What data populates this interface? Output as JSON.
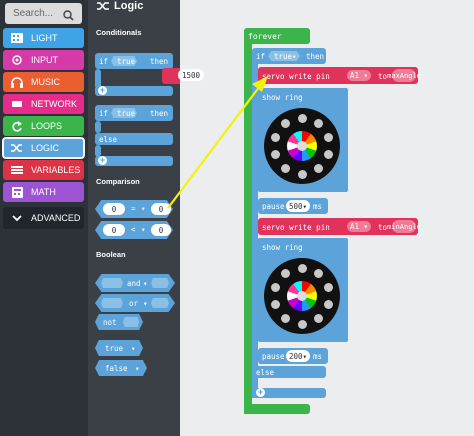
{
  "search": {
    "placeholder": "Search..."
  },
  "categories": [
    {
      "label": "LIGHT",
      "icon": "light-icon",
      "color": "#3fa4e6"
    },
    {
      "label": "INPUT",
      "icon": "input-icon",
      "color": "#d43aa8"
    },
    {
      "label": "MUSIC",
      "icon": "headphones-icon",
      "color": "#ea5e31"
    },
    {
      "label": "NETWORK",
      "icon": "network-icon",
      "color": "#e52c8a"
    },
    {
      "label": "LOOPS",
      "icon": "loop-icon",
      "color": "#3bb54a"
    },
    {
      "label": "LOGIC",
      "icon": "shuffle-icon",
      "color": "#5ba3d9"
    },
    {
      "label": "VARIABLES",
      "icon": "list-icon",
      "color": "#dc3346"
    },
    {
      "label": "MATH",
      "icon": "calculator-icon",
      "color": "#9c54d2"
    },
    {
      "label": "ADVANCED",
      "icon": "chevron-down-icon",
      "color": "#20262b"
    }
  ],
  "flyout": {
    "title": "Logic",
    "sections": {
      "conditionals": "Conditionals",
      "comparison": "Comparison",
      "boolean": "Boolean"
    },
    "if_kw": "if",
    "true_val": "true",
    "then_kw": "then",
    "else_kw": "else",
    "eq_op": "=",
    "lt_op": "<",
    "zero": "0",
    "and_op": "and",
    "or_op": "or",
    "not_op": "not",
    "false_val": "false",
    "partial_value": "1500"
  },
  "workspace": {
    "forever_label": "forever",
    "if_kw": "if",
    "true_val": "true",
    "then_kw": "then",
    "servo1": {
      "label": "servo write pin",
      "pin": "A1",
      "to": "to",
      "value": "maxAngle"
    },
    "show_ring_1": "show ring",
    "pause1": {
      "label": "pause",
      "value": "500",
      "unit": "ms"
    },
    "servo2": {
      "label": "servo write pin",
      "pin": "A1",
      "to": "to",
      "value": "minAngle"
    },
    "show_ring_2": "show ring",
    "pause2": {
      "label": "pause",
      "value": "200",
      "unit": "ms"
    },
    "else_kw": "else"
  },
  "colors": {
    "logic": "#5ba3d9",
    "loops": "#3bb54a",
    "pins": "#e0325a",
    "arrow": "#f2f20a",
    "ring_leds": [
      "#ff0000",
      "#ff8c00",
      "#ffff00",
      "#00c800",
      "#2299ff",
      "#6a00ff",
      "#cc00cc",
      "#ffffff",
      "#ff3399",
      "#00ffff"
    ]
  }
}
